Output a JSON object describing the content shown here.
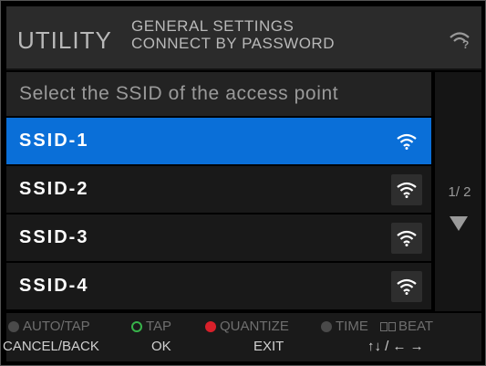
{
  "header": {
    "title": "UTILITY",
    "line1": "GENERAL SETTINGS",
    "line2": "CONNECT BY PASSWORD",
    "status_icon": "wifi-unknown-icon"
  },
  "prompt": "Select the SSID of the access point",
  "networks": [
    {
      "name": "SSID-1",
      "selected": true,
      "icon": "wifi-signal-icon"
    },
    {
      "name": "SSID-2",
      "selected": false,
      "icon": "wifi-signal-icon"
    },
    {
      "name": "SSID-3",
      "selected": false,
      "icon": "wifi-signal-icon"
    },
    {
      "name": "SSID-4",
      "selected": false,
      "icon": "wifi-signal-icon"
    }
  ],
  "pager": {
    "text": "1/ 2"
  },
  "legend": {
    "auto_tap": "AUTO/TAP",
    "tap": "TAP",
    "quantize": "QUANTIZE",
    "time": "TIME",
    "beat": "BEAT"
  },
  "keys": {
    "cancel_back": "CANCEL/BACK",
    "ok": "OK",
    "exit": "EXIT",
    "nav": "↑↓ / ← →"
  },
  "colors": {
    "selected": "#0a6fd8",
    "tap_green": "#37b34a",
    "quantize_red": "#d8202a"
  }
}
